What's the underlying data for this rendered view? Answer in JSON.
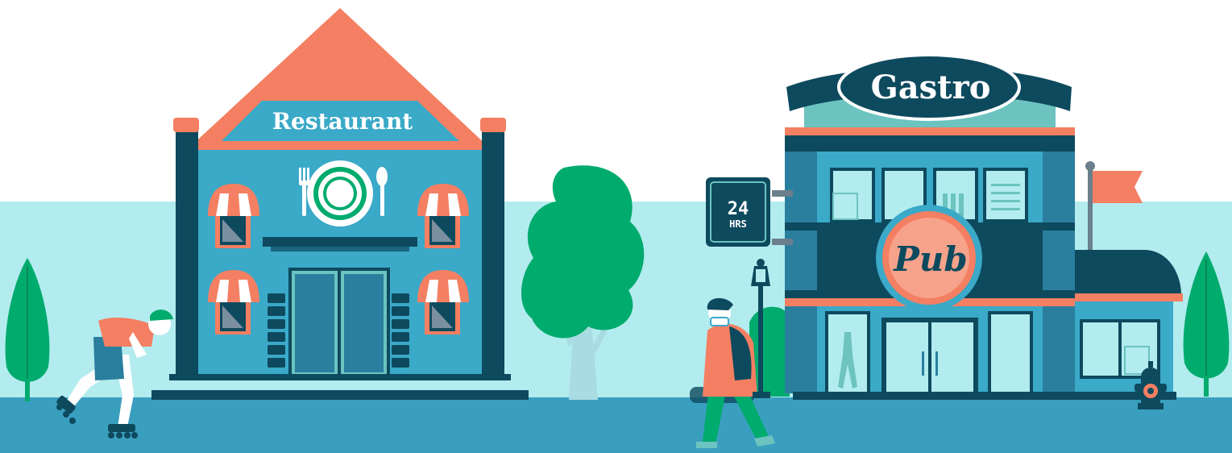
{
  "scene": {
    "restaurant_sign": "Restaurant",
    "gastro_sign": "Gastro",
    "pub_sign": "Pub",
    "hours_sign": {
      "number": "24",
      "unit": "HRS"
    }
  },
  "colors": {
    "sky": "#ffffff",
    "background_band": "#b3ecef",
    "street": "#3a9fbf",
    "building_blue": "#3ba9c8",
    "dark_navy": "#0e4a5e",
    "coral": "#f47f62",
    "teal_light": "#6cc3c0",
    "tree_green": "#00ab6e"
  }
}
